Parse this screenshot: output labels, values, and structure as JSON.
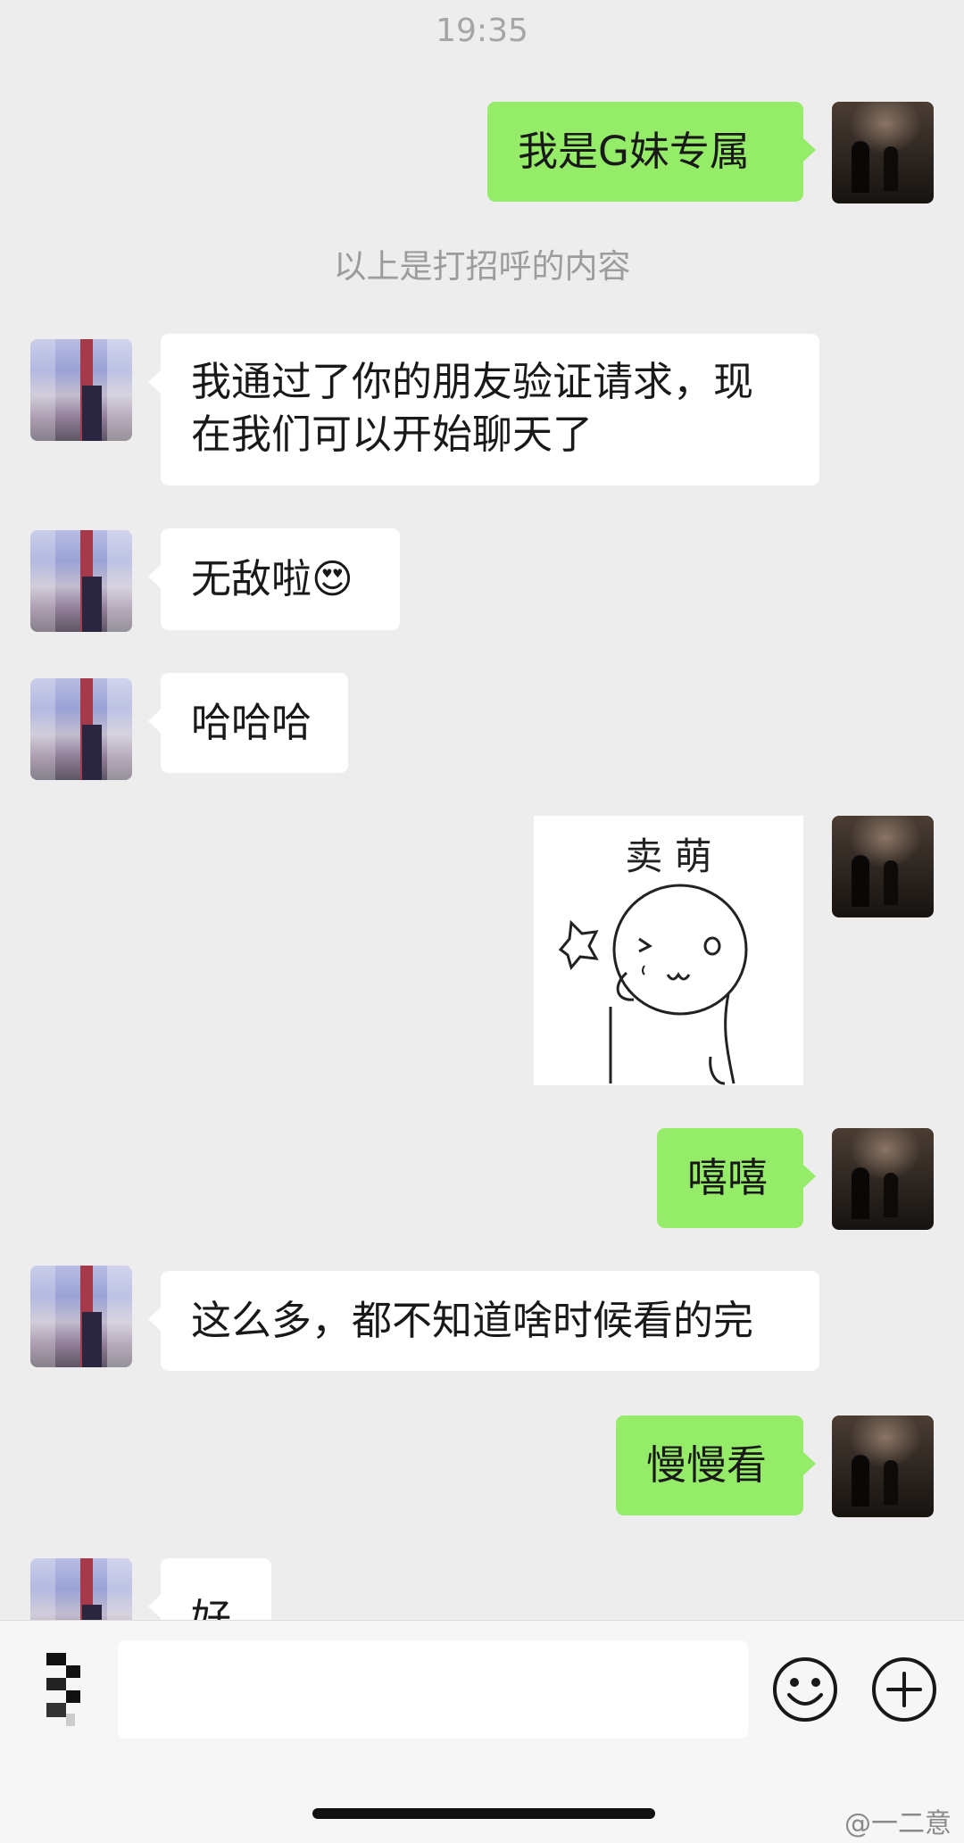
{
  "status": {
    "time": "19:35"
  },
  "system_notice": "以上是打招呼的内容",
  "messages": [
    {
      "side": "out",
      "text": "我是G妹专属"
    },
    {
      "side": "in",
      "line1": "我通过了你的朋友验证请求，现",
      "line2": "在我们可以开始聊天了"
    },
    {
      "side": "in",
      "text": "无敌啦",
      "emoji": "😍"
    },
    {
      "side": "in",
      "text": "哈哈哈"
    },
    {
      "side": "out",
      "type": "sticker",
      "text": "卖  萌"
    },
    {
      "side": "out",
      "text": "嘻嘻"
    },
    {
      "side": "in",
      "text": "这么多，都不知道啥时候看的完"
    },
    {
      "side": "out",
      "text": "慢慢看"
    },
    {
      "side": "in",
      "text": "好"
    }
  ],
  "input": {
    "value": "",
    "voice_icon": "voice-keyboard-icon",
    "emoji_icon": "smiley-emoji-icon",
    "more_icon": "plus-circle-icon"
  },
  "watermark": "@一二意",
  "colors": {
    "background": "#ededed",
    "bubble_out": "#95ec69",
    "bubble_in": "#ffffff"
  }
}
